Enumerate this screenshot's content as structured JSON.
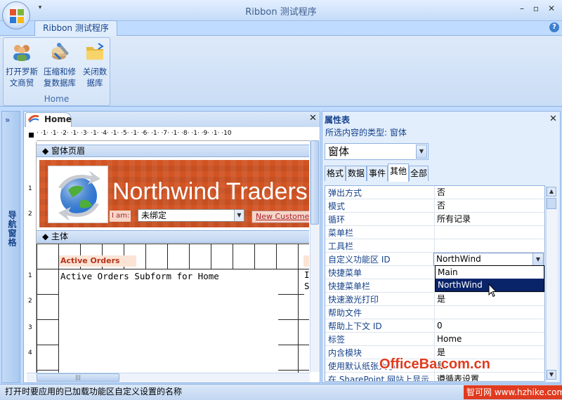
{
  "window": {
    "title": "Ribbon 测试程序",
    "minimize": "–",
    "restore": "▫",
    "close": "✕"
  },
  "qat": {
    "arrow": "▾"
  },
  "ribbon": {
    "tab": "Ribbon 测试程序",
    "help": "?",
    "buttons": [
      {
        "line1": "打开罗斯",
        "line2": "文商贸",
        "icon": "people-icon"
      },
      {
        "line1": "压缩和修",
        "line2": "复数据库",
        "icon": "compact-repair-icon"
      },
      {
        "line1": "关闭数",
        "line2": "据库",
        "icon": "folder-icon"
      }
    ],
    "group_label": "Home"
  },
  "nav": {
    "chevron": "»",
    "label": "导航窗格"
  },
  "document": {
    "tab": "Home",
    "close": "✕",
    "ruler": "· ·1· ·1· ·2· ·1· ·3· ·1· ·4· ·1· ·5· ·1· ·6· ·1· ·7· ·1· ·8· ·1· ·9· ·1· ·10",
    "vruler": [
      "1",
      "2",
      "1",
      "2",
      "3",
      "4"
    ],
    "header_section": "窗体页眉",
    "banner_title": "Northwind Traders",
    "iam_label": "I am:",
    "iam_value": "未绑定",
    "new_customer": "New Customer",
    "body_section": "主体",
    "active_orders_label": "Active Orders",
    "subform_text": "Active Orders Subform for Home",
    "subform2_text": "I S",
    "hscroll_grip": "|||"
  },
  "props": {
    "title": "属性表",
    "close": "✕",
    "type_label": "所选内容的类型: 窗体",
    "object": "窗体",
    "tabs": [
      "格式",
      "数据",
      "事件",
      "其他",
      "全部"
    ],
    "active_tab": "其他",
    "rows": [
      {
        "k": "弹出方式",
        "v": "否"
      },
      {
        "k": "模式",
        "v": "否"
      },
      {
        "k": "循环",
        "v": "所有记录"
      },
      {
        "k": "菜单栏",
        "v": ""
      },
      {
        "k": "工具栏",
        "v": ""
      },
      {
        "k": "自定义功能区 ID",
        "v": "NorthWind"
      },
      {
        "k": "快捷菜单",
        "v": ""
      },
      {
        "k": "快捷菜单栏",
        "v": ""
      },
      {
        "k": "快速激光打印",
        "v": "是"
      },
      {
        "k": "帮助文件",
        "v": ""
      },
      {
        "k": "帮助上下文 ID",
        "v": "0"
      },
      {
        "k": "标签",
        "v": "Home"
      },
      {
        "k": "内含模块",
        "v": "是"
      },
      {
        "k": "使用默认纸张大小",
        "v": "是"
      },
      {
        "k": "在 SharePoint 网站上显示",
        "v": "遵循表设置"
      }
    ],
    "dropdown_options": [
      "Main",
      "NorthWind"
    ],
    "dropdown_selected": "NorthWind"
  },
  "status": {
    "text": "打开时要应用的已加载功能区自定义设置的名称"
  },
  "watermark": {
    "main": "OfficeBa.com.cn",
    "corner": "智可网 www.hzhike.com"
  },
  "colors": {
    "accent": "#15428b",
    "banner": "#d25423",
    "selection": "#0a246a"
  }
}
